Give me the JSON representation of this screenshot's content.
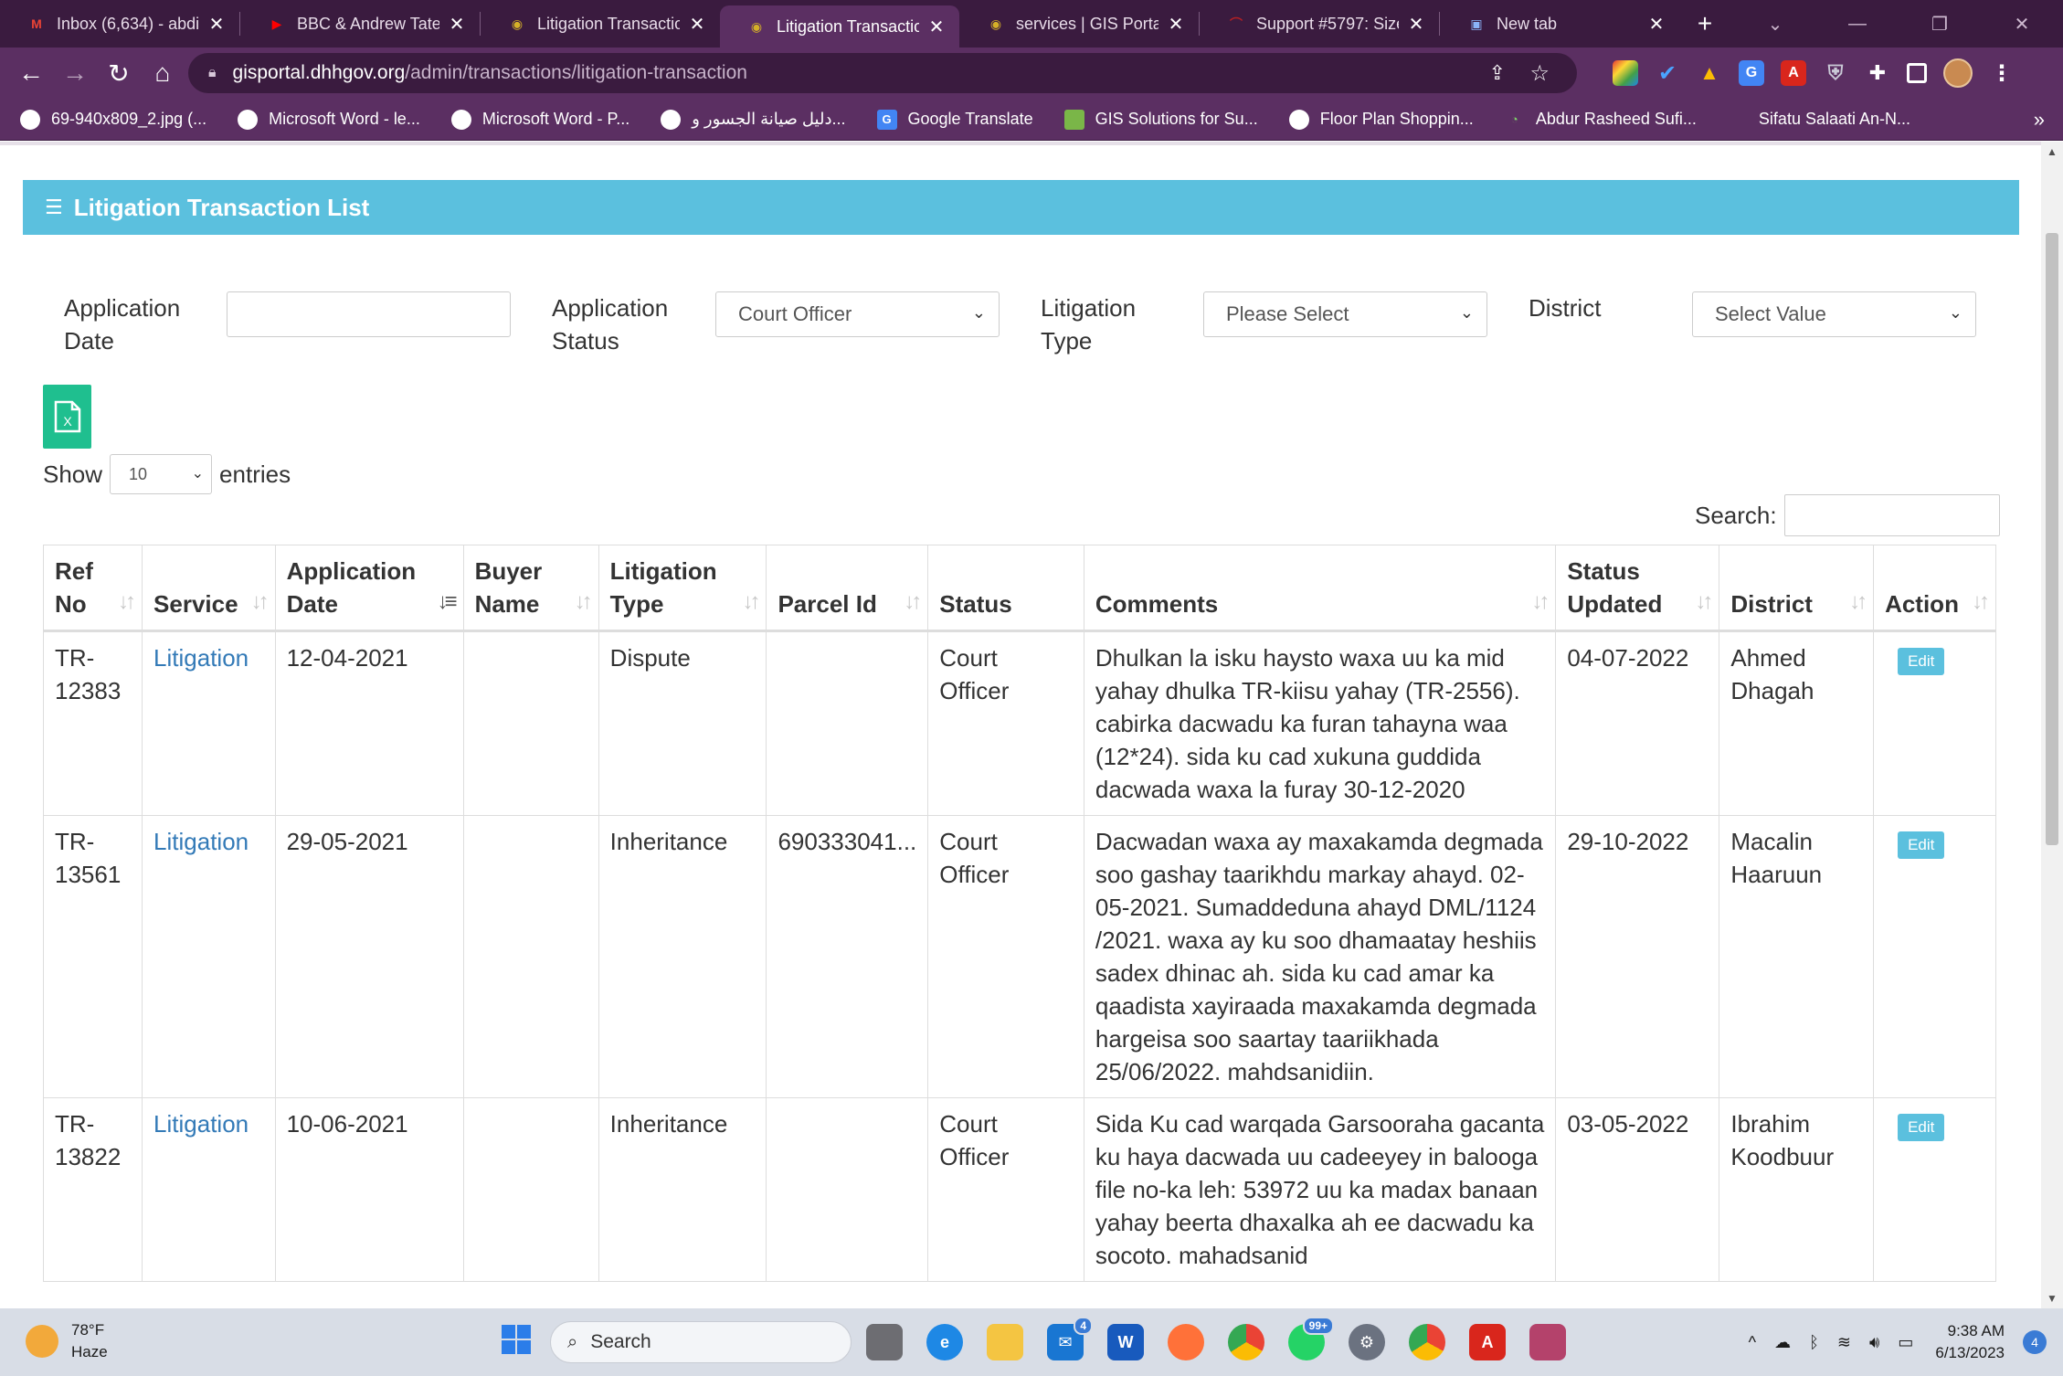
{
  "browser": {
    "tabs": [
      {
        "title": "Inbox (6,634) - abdir",
        "icon": "gmail-icon",
        "active": false,
        "color": "#ea4335",
        "glyph": "M"
      },
      {
        "title": "BBC & Andrew Tate |",
        "icon": "youtube-icon",
        "active": false,
        "color": "#ff0000",
        "glyph": "▶"
      },
      {
        "title": "Litigation Transactior",
        "icon": "gis-logo-icon",
        "active": false,
        "color": "#d4b028",
        "glyph": "◉"
      },
      {
        "title": "Litigation Transactior",
        "icon": "gis-logo-icon",
        "active": true,
        "color": "#d4b028",
        "glyph": "◉"
      },
      {
        "title": "services | GIS Portal",
        "icon": "gis-logo-icon",
        "active": false,
        "color": "#d4b028",
        "glyph": "◉"
      },
      {
        "title": "Support #5797: Size",
        "icon": "redmine-icon",
        "active": false,
        "color": "#b32024",
        "glyph": "⌒"
      },
      {
        "title": "New tab",
        "icon": "newtab-icon",
        "active": false,
        "color": "#8ab4f8",
        "glyph": "▣"
      }
    ],
    "url_host": "gisportal.dhhgov.org",
    "url_path": "/admin/transactions/litigation-transaction",
    "bookmarks": [
      {
        "label": "69-940x809_2.jpg (...",
        "icon": "globe-icon"
      },
      {
        "label": "Microsoft Word - le...",
        "icon": "globe-icon"
      },
      {
        "label": "Microsoft Word - P...",
        "icon": "globe-icon"
      },
      {
        "label": "دليل صيانة الجسور و...",
        "icon": "globe-icon"
      },
      {
        "label": "Google Translate",
        "icon": "translate-icon"
      },
      {
        "label": "GIS Solutions for Su...",
        "icon": "gis-icon"
      },
      {
        "label": "Floor Plan Shoppin...",
        "icon": "globe-icon"
      },
      {
        "label": "Abdur Rasheed Sufi...",
        "icon": "audiomack-icon"
      },
      {
        "label": "Sifatu Salaati An-N...",
        "icon": "blank-icon"
      }
    ]
  },
  "page": {
    "panel_title": "Litigation Transaction List",
    "filters": {
      "application_date_label_1": "Application",
      "application_date_label_2": "Date",
      "application_status_label_1": "Application",
      "application_status_label_2": "Status",
      "application_status_value": "Court Officer",
      "litigation_type_label_1": "Litigation",
      "litigation_type_label_2": "Type",
      "litigation_type_value": "Please Select",
      "district_label": "District",
      "district_value": "Select Value"
    },
    "show_label": "Show",
    "entries_value": "10",
    "entries_label": "entries",
    "search_label": "Search:",
    "columns": [
      {
        "l1": "Ref",
        "l2": "No",
        "sort": "both"
      },
      {
        "l1": "",
        "l2": "Service",
        "sort": "both"
      },
      {
        "l1": "Application",
        "l2": "Date",
        "sort": "desc"
      },
      {
        "l1": "Buyer",
        "l2": "Name",
        "sort": "both"
      },
      {
        "l1": "Litigation",
        "l2": "Type",
        "sort": "both"
      },
      {
        "l1": "",
        "l2": "Parcel Id",
        "sort": "both"
      },
      {
        "l1": "",
        "l2": "Status",
        "sort": "none"
      },
      {
        "l1": "",
        "l2": "Comments",
        "sort": "both"
      },
      {
        "l1": "Status",
        "l2": "Updated",
        "sort": "both"
      },
      {
        "l1": "",
        "l2": "District",
        "sort": "both"
      },
      {
        "l1": "",
        "l2": "Action",
        "sort": "both"
      }
    ],
    "rows": [
      {
        "ref_1": "TR-",
        "ref_2": "12383",
        "service": "Litigation",
        "application_date": "12-04-2021",
        "buyer_name": "",
        "litigation_type": "Dispute",
        "parcel_id": "",
        "status": "Court Officer",
        "comments": [
          "Dhulkan la isku haysto waxa uu ka mid",
          "yahay dhulka TR-kiisu yahay (TR-2556).",
          "cabirka dacwadu ka furan tahayna waa",
          "(12*24). sida ku cad xukuna guddida",
          "dacwada waxa la furay 30-12-2020"
        ],
        "status_updated": "04-07-2022",
        "district_1": "Ahmed",
        "district_2": "Dhagah",
        "action": "Edit"
      },
      {
        "ref_1": "TR-",
        "ref_2": "13561",
        "service": "Litigation",
        "application_date": "29-05-2021",
        "buyer_name": "",
        "litigation_type": "Inheritance",
        "parcel_id": "690333041...",
        "status": "Court Officer",
        "comments": [
          "Dacwadan waxa ay maxakamda degmada",
          "soo gashay taarikhdu markay ahayd. 02-",
          "05-2021. Sumaddeduna ahayd DML/1124",
          "/2021. waxa ay ku soo dhamaatay heshiis",
          "sadex dhinac ah. sida ku cad amar ka",
          "qaadista xayiraada maxakamda degmada",
          "hargeisa soo saartay taariikhada",
          "25/06/2022. mahdsanidiin."
        ],
        "status_updated": "29-10-2022",
        "district_1": "Macalin",
        "district_2": "Haaruun",
        "action": "Edit"
      },
      {
        "ref_1": "TR-",
        "ref_2": "13822",
        "service": "Litigation",
        "application_date": "10-06-2021",
        "buyer_name": "",
        "litigation_type": "Inheritance",
        "parcel_id": "",
        "status": "Court Officer",
        "comments": [
          "Sida Ku cad warqada Garsooraha gacanta",
          "ku haya dacwada uu cadeeyey in balooga",
          "file no-ka leh: 53972 uu ka madax banaan",
          "yahay beerta dhaxalka ah ee dacwadu ka",
          "socoto. mahadsanid"
        ],
        "status_updated": "03-05-2022",
        "district_1": "Ibrahim",
        "district_2": "Koodbuur",
        "action": "Edit"
      }
    ]
  },
  "taskbar": {
    "temperature": "78°F",
    "weather": "Haze",
    "search_placeholder": "Search",
    "mail_badge": "4",
    "whatsapp_badge": "99+",
    "time": "9:38 AM",
    "date": "6/13/2023",
    "notification_count": "4"
  },
  "colors": {
    "panel_header": "#5bc0de",
    "excel_button": "#1fbf8f",
    "link": "#337ab7",
    "browser_frame": "#5b2f62"
  }
}
